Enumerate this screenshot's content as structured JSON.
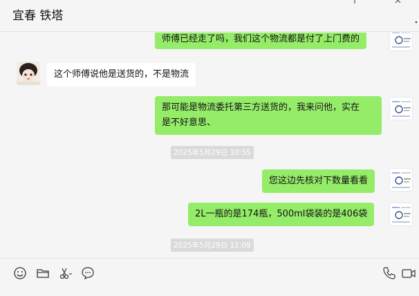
{
  "header": {
    "title": "宜春 铁塔"
  },
  "messages": [
    {
      "dir": "out",
      "text": "师傅已经走了吗，我们这个物流都是付了上门费的"
    },
    {
      "dir": "in",
      "text": "这个师傅说他是送货的，不是物流"
    },
    {
      "dir": "out",
      "line1": "那可能是物流委托第三方送货的，我来问他，实在",
      "line2": "是不好意思、"
    },
    {
      "dir": "out",
      "text": "您这边先核对下数量看看"
    },
    {
      "dir": "out",
      "text": "2L一瓶的是174瓶，500ml袋装的是406袋"
    }
  ],
  "timestamps": [
    "2025年5月29日 10:55",
    "2025年5月29日 11:09"
  ],
  "toolbar": {
    "left_icons": [
      "emoji-icon",
      "folder-icon",
      "scissors-icon",
      "chat-bubble-icon"
    ],
    "right_icons": [
      "phone-icon",
      "video-icon"
    ]
  },
  "colors": {
    "outgoing_bubble": "#95ec69",
    "incoming_bubble": "#ffffff",
    "background": "#f5f5f5"
  }
}
